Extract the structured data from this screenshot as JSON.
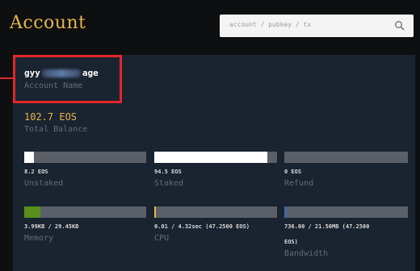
{
  "header": {
    "title": "Account",
    "search_placeholder": "account / pubkey / tx"
  },
  "account": {
    "name_prefix": "gyy",
    "name_suffix": "age",
    "name_label": "Account Name"
  },
  "balance": {
    "value": "102.7 EOS",
    "label": "Total Balance"
  },
  "resources": [
    {
      "value": "8.2 EOS",
      "label": "Unstaked",
      "fill_fraction": 0.08,
      "color": "#ffffff"
    },
    {
      "value": "94.5 EOS",
      "label": "Staked",
      "fill_fraction": 0.92,
      "color": "#ffffff"
    },
    {
      "value": "0 EOS",
      "label": "Refund",
      "fill_fraction": 0.0,
      "color": "#ffffff"
    },
    {
      "value": "3.99KB / 29.45KB",
      "label": "Memory",
      "fill_fraction": 0.135,
      "color": "#5a8f1c"
    },
    {
      "value": "0.01 / 4.32sec (47.2500 EOS)",
      "label": "CPU",
      "fill_fraction": 0.01,
      "color": "#e6b54a"
    },
    {
      "value": "736.00 / 21.50MB (47.2500",
      "value_cont": "EOS)",
      "label": "Bandwidth",
      "fill_fraction": 0.01,
      "color": "#2c6fbd"
    }
  ],
  "colors": {
    "accent": "#e6b54a",
    "highlight": "#e3262b",
    "card_bg": "#1a2330"
  }
}
